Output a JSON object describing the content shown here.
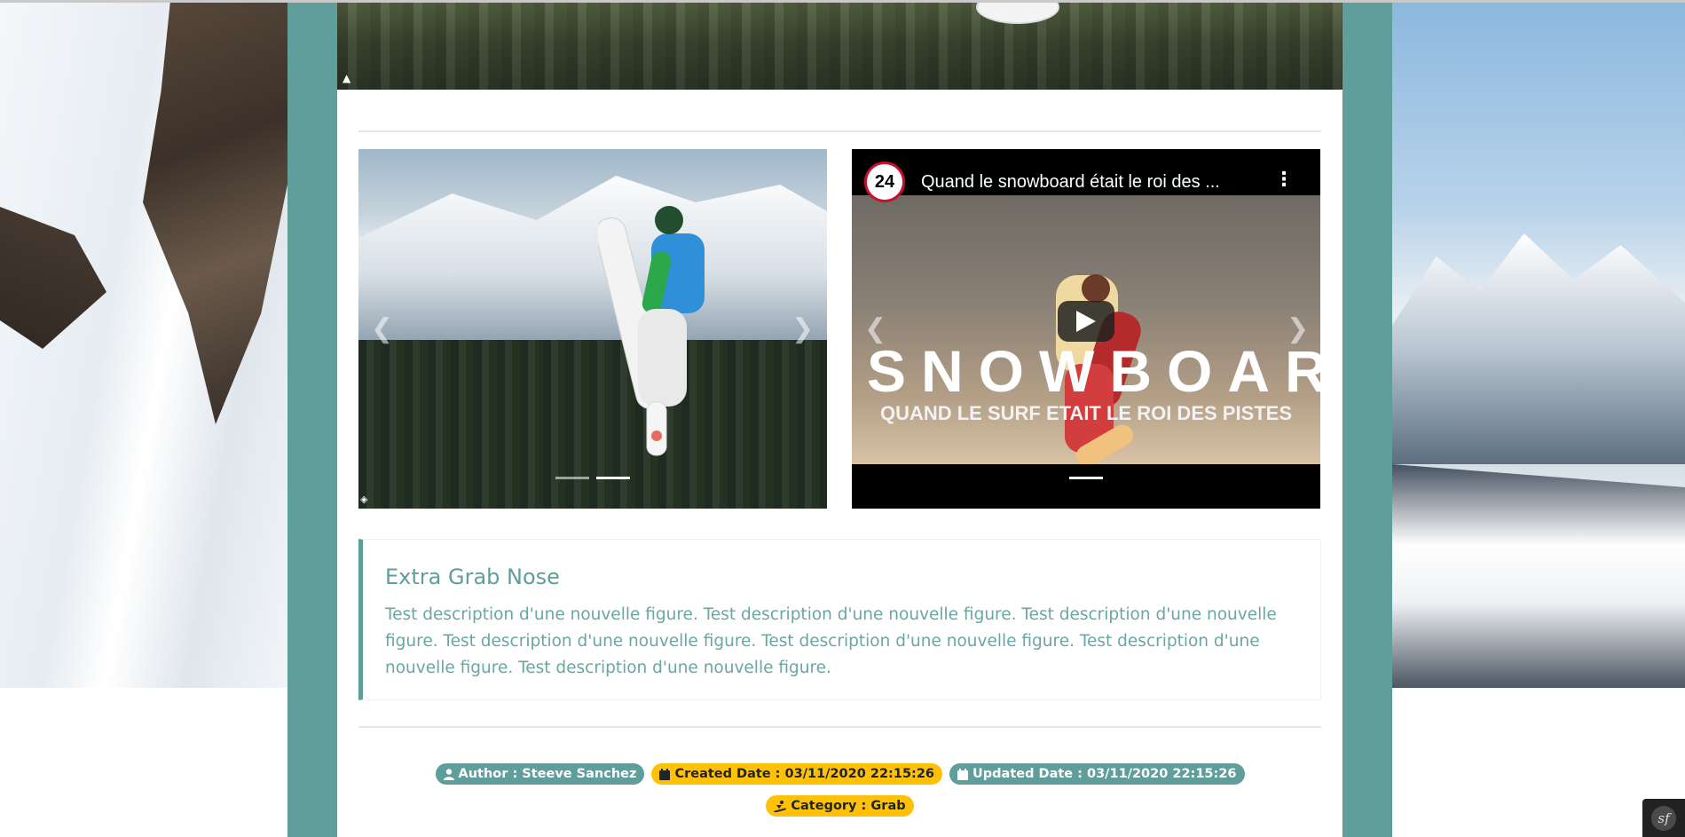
{
  "figure": {
    "image_carousel": {
      "prev_icon": "chevron-left-icon",
      "next_icon": "chevron-right-icon",
      "indicators": 2,
      "active_indicator": 2
    },
    "video_carousel": {
      "channel_logo": "24",
      "video_title": "Quand le snowboard était le roi des ...",
      "overlay_title": "SNOWBOARD",
      "overlay_subtitle": "QUAND LE SURF ETAIT LE ROI DES PISTES",
      "play_icon": "play-icon",
      "menu_icon": "kebab-menu-icon",
      "indicators": 1
    },
    "title": "Extra Grab Nose",
    "description": "Test description d'une nouvelle figure. Test description d'une nouvelle figure. Test description d'une nouvelle figure. Test description d'une nouvelle figure. Test description d'une nouvelle figure. Test description d'une nouvelle figure. Test description d'une nouvelle figure.",
    "badges": {
      "author": "Author : Steeve Sanchez",
      "created": "Created Date : 03/11/2020 22:15:26",
      "updated": "Updated Date : 03/11/2020 22:15:26",
      "category": "Category : Grab"
    }
  },
  "toolbar": {
    "symfony_label": "sf"
  },
  "colors": {
    "accent_teal": "#5f9e9a",
    "badge_yellow": "#ffc107"
  }
}
